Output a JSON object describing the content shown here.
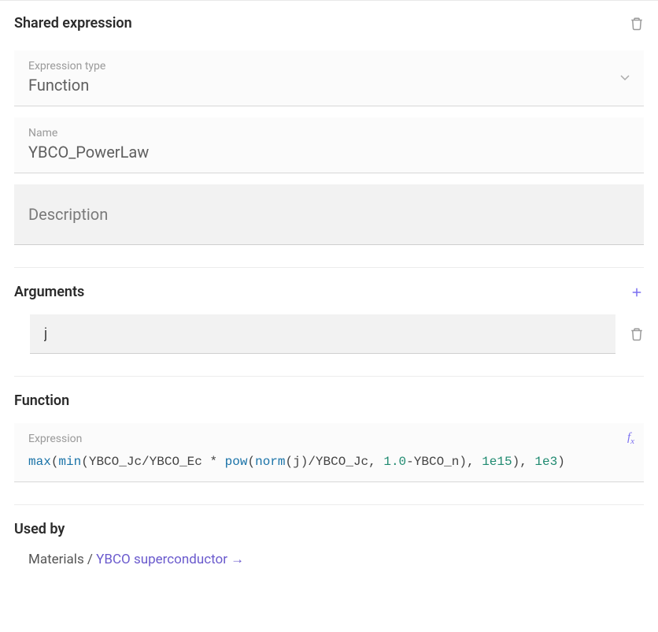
{
  "header": {
    "title": "Shared expression"
  },
  "expression_type": {
    "label": "Expression type",
    "value": "Function"
  },
  "name": {
    "label": "Name",
    "value": "YBCO_PowerLaw"
  },
  "description": {
    "placeholder": "Description",
    "value": ""
  },
  "arguments": {
    "title": "Arguments",
    "items": [
      {
        "value": "j"
      }
    ]
  },
  "function": {
    "title": "Function",
    "expression_label": "Expression",
    "tokens": [
      {
        "t": "fn",
        "v": "max"
      },
      {
        "t": "p",
        "v": "("
      },
      {
        "t": "fn",
        "v": "min"
      },
      {
        "t": "p",
        "v": "("
      },
      {
        "t": "id",
        "v": "YBCO_Jc/YBCO_Ec * "
      },
      {
        "t": "fn",
        "v": "pow"
      },
      {
        "t": "p",
        "v": "("
      },
      {
        "t": "fn",
        "v": "norm"
      },
      {
        "t": "p",
        "v": "("
      },
      {
        "t": "id",
        "v": "j"
      },
      {
        "t": "p",
        "v": ")"
      },
      {
        "t": "id",
        "v": "/YBCO_Jc, "
      },
      {
        "t": "num",
        "v": "1.0"
      },
      {
        "t": "id",
        "v": "-YBCO_n"
      },
      {
        "t": "p",
        "v": "), "
      },
      {
        "t": "num",
        "v": "1e15"
      },
      {
        "t": "p",
        "v": "), "
      },
      {
        "t": "num",
        "v": "1e3"
      },
      {
        "t": "p",
        "v": ")"
      }
    ]
  },
  "used_by": {
    "title": "Used by",
    "prefix": "Materials / ",
    "link": "YBCO superconductor →"
  }
}
